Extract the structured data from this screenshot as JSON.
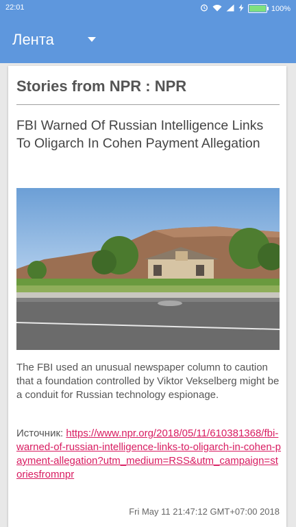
{
  "status_bar": {
    "time": "22:01",
    "battery_percent": "100%",
    "battery_level": 1.0,
    "icons": [
      "alarm-icon",
      "wifi-icon",
      "signal-icon",
      "charging-icon",
      "battery-icon"
    ]
  },
  "app_bar": {
    "title": "Лента",
    "background": "#5e97dd"
  },
  "article": {
    "feed_title": "Stories from NPR : NPR",
    "headline": "FBI Warned Of Russian Intelligence Links To Oligarch In Cohen Payment Allegation",
    "summary": "The FBI used an unusual newspaper column to caution that a foundation controlled by Viktor Vekselberg might be a conduit for Russian technology espionage.",
    "source_label": "Источник: ",
    "source_url": "https://www.npr.org/2018/05/11/610381368/fbi-warned-of-russian-intelligence-links-to-oligarch-in-cohen-payment-allegation?utm_medium=RSS&utm_campaign=storiesfromnpr",
    "date": "Fri May 11 21:47:12 GMT+07:00 2018",
    "link_color": "#d81b60"
  }
}
